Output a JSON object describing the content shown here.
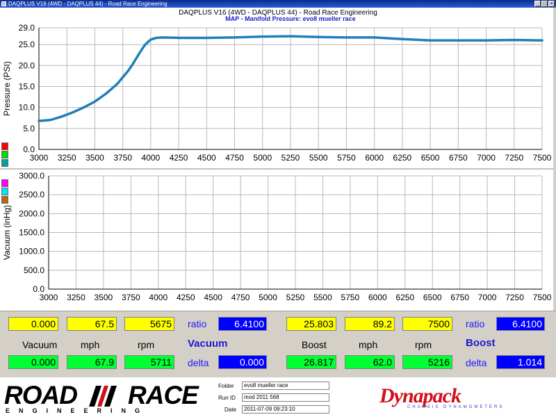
{
  "window": {
    "title": "DAQPLUS V16 (4WD - DAQPLUS 44) - Road Race Engineering"
  },
  "chart_header": "DAQPLUS V16 (4WD - DAQPLUS 44) - Road Race Engineering",
  "chart_data": [
    {
      "type": "line",
      "title": "MAP - Manifold Pressure: evo8 mueller race",
      "ylabel": "Pressure (PSI)",
      "xlabel": "",
      "xlim": [
        3000,
        7500
      ],
      "ylim": [
        0,
        29
      ],
      "x_ticks": [
        3000,
        3250,
        3500,
        3750,
        4000,
        4250,
        4500,
        4750,
        5000,
        5250,
        5500,
        5750,
        6000,
        6250,
        6500,
        6750,
        7000,
        7250,
        7500
      ],
      "x_tick_labels": [
        "3000",
        "3250",
        "3500",
        "3750",
        "4000",
        "4250",
        "4500",
        "4750",
        "5000",
        "5250",
        "5500",
        "5750",
        "6000",
        "6250",
        "6500",
        "6750",
        "7000",
        "7250",
        "7500"
      ],
      "y_ticks": [
        0,
        5,
        10,
        15,
        20,
        25,
        29
      ],
      "y_tick_labels": [
        "0.0",
        "5.0",
        "10.0",
        "15.0",
        "20.0",
        "25.0",
        "29.0"
      ],
      "grid": true,
      "series": [
        {
          "color": "#1f7fb8",
          "x": [
            3000,
            3100,
            3200,
            3300,
            3400,
            3500,
            3600,
            3700,
            3800,
            3850,
            3900,
            3950,
            4000,
            4050,
            4100,
            4250,
            4500,
            4750,
            5000,
            5250,
            5500,
            5750,
            6000,
            6250,
            6500,
            6750,
            7000,
            7250,
            7500
          ],
          "y": [
            6.8,
            7.0,
            7.8,
            8.8,
            10.0,
            11.4,
            13.3,
            15.6,
            18.8,
            20.8,
            23.0,
            25.0,
            26.2,
            26.6,
            26.7,
            26.6,
            26.6,
            26.7,
            26.9,
            27.0,
            26.8,
            26.7,
            26.7,
            26.3,
            26.0,
            26.0,
            26.0,
            26.1,
            26.0
          ]
        }
      ]
    },
    {
      "type": "line",
      "title": "",
      "ylabel": "Vacuum (inHg)",
      "xlabel": "",
      "xlim": [
        3000,
        7500
      ],
      "ylim": [
        0,
        3000
      ],
      "x_ticks": [
        3000,
        3250,
        3500,
        3750,
        4000,
        4250,
        4500,
        4750,
        5000,
        5250,
        5500,
        5750,
        6000,
        6250,
        6500,
        6750,
        7000,
        7250,
        7500
      ],
      "x_tick_labels": [
        "3000",
        "3250",
        "3500",
        "3750",
        "4000",
        "4250",
        "4500",
        "4750",
        "5000",
        "5250",
        "5500",
        "5750",
        "6000",
        "6250",
        "6500",
        "6750",
        "7000",
        "7250",
        "7500"
      ],
      "y_ticks": [
        0,
        500,
        1000,
        1500,
        2000,
        2500,
        3000
      ],
      "y_tick_labels": [
        "0.0",
        "500.0",
        "1000.0",
        "1500.0",
        "2000.0",
        "2500.0",
        "3000.0"
      ],
      "grid": true,
      "series": []
    }
  ],
  "legend_chips": {
    "top": [
      "#ff0000",
      "#00dd00",
      "#00a0a0"
    ],
    "bottom": [
      "#ff00ff",
      "#00e5ff",
      "#c06010"
    ]
  },
  "panel": {
    "left": {
      "top_values": [
        "0.000",
        "67.5",
        "5675"
      ],
      "ratio_label": "ratio",
      "ratio_value": "6.4100",
      "headers": [
        "Vacuum",
        "mph",
        "rpm"
      ],
      "section_label": "Vacuum",
      "bottom_values": [
        "0.000",
        "67.9",
        "5711"
      ],
      "delta_label": "delta",
      "delta_value": "0.000"
    },
    "right": {
      "top_values": [
        "25.803",
        "89.2",
        "7500"
      ],
      "ratio_label": "ratio",
      "ratio_value": "6.4100",
      "headers": [
        "Boost",
        "mph",
        "rpm"
      ],
      "section_label": "Boost",
      "bottom_values": [
        "26.817",
        "62.0",
        "5216"
      ],
      "delta_label": "delta",
      "delta_value": "1.014"
    }
  },
  "footer": {
    "logo_left_word": "ROAD",
    "logo_right_word": "RACE",
    "logo_subtitle": "ENGINEERING",
    "fields": [
      {
        "label": "Folder",
        "value": "evo8 mueller race"
      },
      {
        "label": "Run ID",
        "value": "mod 2011 568"
      },
      {
        "label": "Date",
        "value": "2011-07-09 09:23:10"
      }
    ],
    "brand_name": "Dynapack",
    "brand_tagline": "CHASSIS DYNAMOMETERS"
  }
}
